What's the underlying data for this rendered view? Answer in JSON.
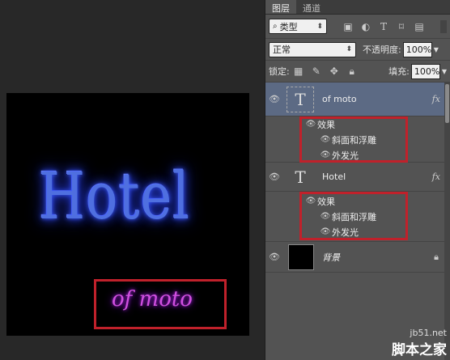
{
  "tabs": [
    "图层",
    "通道"
  ],
  "filter": {
    "label": "类型"
  },
  "blend": {
    "mode": "正常",
    "opacity_label": "不透明度:",
    "opacity": "100%"
  },
  "lock": {
    "label": "锁定:",
    "fill_label": "填充:",
    "fill": "100%"
  },
  "layers": [
    {
      "name": "of moto",
      "fx": "fx",
      "effects_label": "效果",
      "effects": [
        "斜面和浮雕",
        "外发光"
      ],
      "selected": true
    },
    {
      "name": "Hotel",
      "fx": "fx",
      "effects_label": "效果",
      "effects": [
        "斜面和浮雕",
        "外发光"
      ],
      "selected": false
    },
    {
      "name": "背景"
    }
  ],
  "canvas": {
    "main_text": "Hotel",
    "sub_text": "of moto"
  },
  "watermark": {
    "url": "jb51.net",
    "name": "脚本之家"
  },
  "colors": {
    "panel_bg": "#535353",
    "highlight": "#c0212b",
    "selected_layer": "#5c6a84"
  }
}
